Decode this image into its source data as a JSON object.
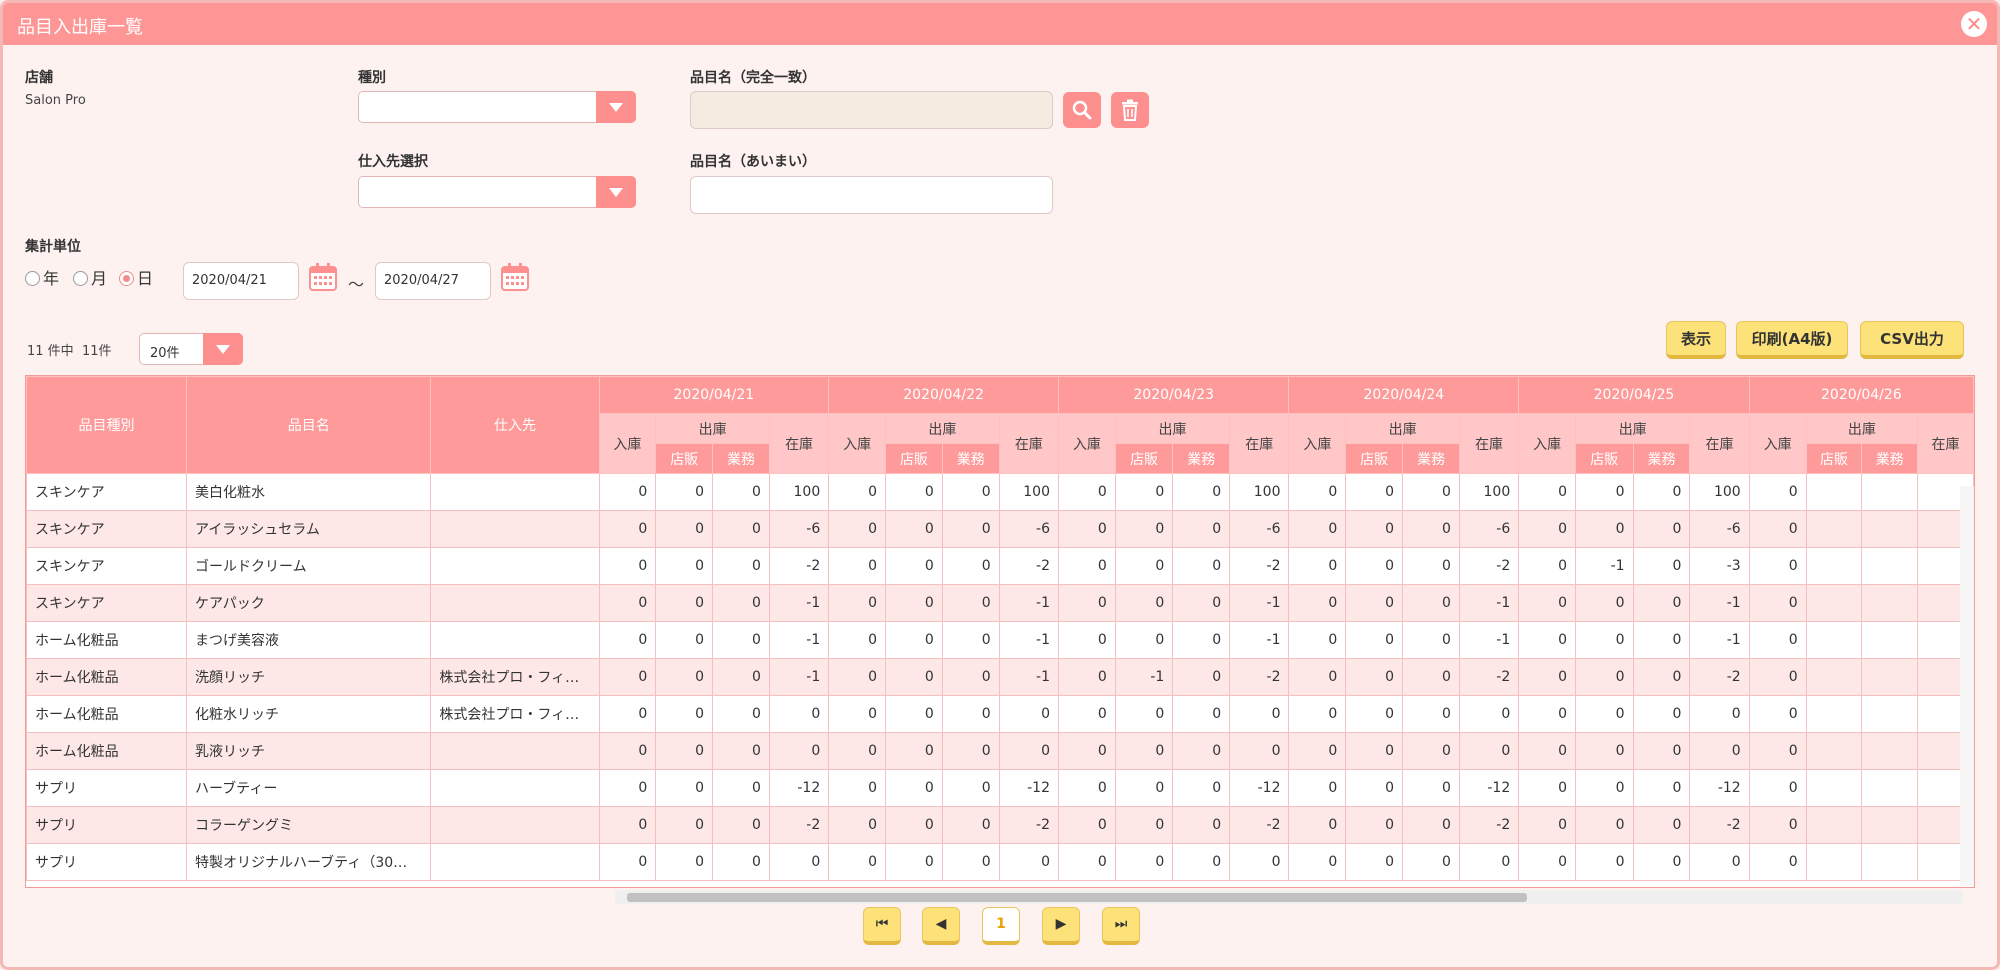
{
  "window": {
    "title": "品目入出庫一覧",
    "close_glyph": "✕"
  },
  "filters": {
    "store_label": "店舗",
    "store_value": "Salon Pro",
    "category_label": "種別",
    "category_value": "",
    "supplier_label": "仕入先選択",
    "supplier_value": "",
    "item_exact_label": "品目名（完全一致）",
    "item_exact_value": "",
    "item_fuzzy_label": "品目名（あいまい）",
    "item_fuzzy_value": "",
    "unit_label": "集計単位",
    "unit_options": [
      "年",
      "月",
      "日"
    ],
    "unit_selected": "日",
    "date_from": "2020/04/21",
    "date_sep": "～",
    "date_to": "2020/04/27"
  },
  "summary": {
    "count_text": "11 件中  11件",
    "page_size": "20件"
  },
  "actions": {
    "show": "表示",
    "print": "印刷(A4版)",
    "csv": "CSV出力"
  },
  "table": {
    "headers": {
      "category": "品目種別",
      "item": "品目名",
      "supplier": "仕入先",
      "in": "入庫",
      "out": "出庫",
      "stock": "在庫",
      "store_sale": "店販",
      "business": "業務"
    },
    "dates": [
      "2020/04/21",
      "2020/04/22",
      "2020/04/23",
      "2020/04/24",
      "2020/04/25",
      "2020/04/26"
    ],
    "rows": [
      {
        "category": "スキンケア",
        "item": "美白化粧水",
        "supplier": "",
        "values": [
          [
            0,
            0,
            0,
            100
          ],
          [
            0,
            0,
            0,
            100
          ],
          [
            0,
            0,
            0,
            100
          ],
          [
            0,
            0,
            0,
            100
          ],
          [
            0,
            0,
            0,
            100
          ],
          [
            0
          ]
        ]
      },
      {
        "category": "スキンケア",
        "item": "アイラッシュセラム",
        "supplier": "",
        "values": [
          [
            0,
            0,
            0,
            -6
          ],
          [
            0,
            0,
            0,
            -6
          ],
          [
            0,
            0,
            0,
            -6
          ],
          [
            0,
            0,
            0,
            -6
          ],
          [
            0,
            0,
            0,
            -6
          ],
          [
            0
          ]
        ]
      },
      {
        "category": "スキンケア",
        "item": "ゴールドクリーム",
        "supplier": "",
        "values": [
          [
            0,
            0,
            0,
            -2
          ],
          [
            0,
            0,
            0,
            -2
          ],
          [
            0,
            0,
            0,
            -2
          ],
          [
            0,
            0,
            0,
            -2
          ],
          [
            0,
            -1,
            0,
            -3
          ],
          [
            0
          ]
        ]
      },
      {
        "category": "スキンケア",
        "item": "ケアパック",
        "supplier": "",
        "values": [
          [
            0,
            0,
            0,
            -1
          ],
          [
            0,
            0,
            0,
            -1
          ],
          [
            0,
            0,
            0,
            -1
          ],
          [
            0,
            0,
            0,
            -1
          ],
          [
            0,
            0,
            0,
            -1
          ],
          [
            0
          ]
        ]
      },
      {
        "category": "ホーム化粧品",
        "item": "まつげ美容液",
        "supplier": "",
        "values": [
          [
            0,
            0,
            0,
            -1
          ],
          [
            0,
            0,
            0,
            -1
          ],
          [
            0,
            0,
            0,
            -1
          ],
          [
            0,
            0,
            0,
            -1
          ],
          [
            0,
            0,
            0,
            -1
          ],
          [
            0
          ]
        ]
      },
      {
        "category": "ホーム化粧品",
        "item": "洗顔リッチ",
        "supplier": "株式会社プロ・フィ…",
        "values": [
          [
            0,
            0,
            0,
            -1
          ],
          [
            0,
            0,
            0,
            -1
          ],
          [
            0,
            -1,
            0,
            -2
          ],
          [
            0,
            0,
            0,
            -2
          ],
          [
            0,
            0,
            0,
            -2
          ],
          [
            0
          ]
        ]
      },
      {
        "category": "ホーム化粧品",
        "item": "化粧水リッチ",
        "supplier": "株式会社プロ・フィ…",
        "values": [
          [
            0,
            0,
            0,
            0
          ],
          [
            0,
            0,
            0,
            0
          ],
          [
            0,
            0,
            0,
            0
          ],
          [
            0,
            0,
            0,
            0
          ],
          [
            0,
            0,
            0,
            0
          ],
          [
            0
          ]
        ]
      },
      {
        "category": "ホーム化粧品",
        "item": "乳液リッチ",
        "supplier": "",
        "values": [
          [
            0,
            0,
            0,
            0
          ],
          [
            0,
            0,
            0,
            0
          ],
          [
            0,
            0,
            0,
            0
          ],
          [
            0,
            0,
            0,
            0
          ],
          [
            0,
            0,
            0,
            0
          ],
          [
            0
          ]
        ]
      },
      {
        "category": "サプリ",
        "item": "ハーブティー",
        "supplier": "",
        "values": [
          [
            0,
            0,
            0,
            -12
          ],
          [
            0,
            0,
            0,
            -12
          ],
          [
            0,
            0,
            0,
            -12
          ],
          [
            0,
            0,
            0,
            -12
          ],
          [
            0,
            0,
            0,
            -12
          ],
          [
            0
          ]
        ]
      },
      {
        "category": "サプリ",
        "item": "コラーゲングミ",
        "supplier": "",
        "values": [
          [
            0,
            0,
            0,
            -2
          ],
          [
            0,
            0,
            0,
            -2
          ],
          [
            0,
            0,
            0,
            -2
          ],
          [
            0,
            0,
            0,
            -2
          ],
          [
            0,
            0,
            0,
            -2
          ],
          [
            0
          ]
        ]
      },
      {
        "category": "サプリ",
        "item": "特製オリジナルハーブティ（30…",
        "supplier": "",
        "values": [
          [
            0,
            0,
            0,
            0
          ],
          [
            0,
            0,
            0,
            0
          ],
          [
            0,
            0,
            0,
            0
          ],
          [
            0,
            0,
            0,
            0
          ],
          [
            0,
            0,
            0,
            0
          ],
          [
            0
          ]
        ]
      }
    ]
  },
  "pagination": {
    "first": "⏮",
    "prev": "◀",
    "current": "1",
    "next": "▶",
    "last": "⏭"
  }
}
